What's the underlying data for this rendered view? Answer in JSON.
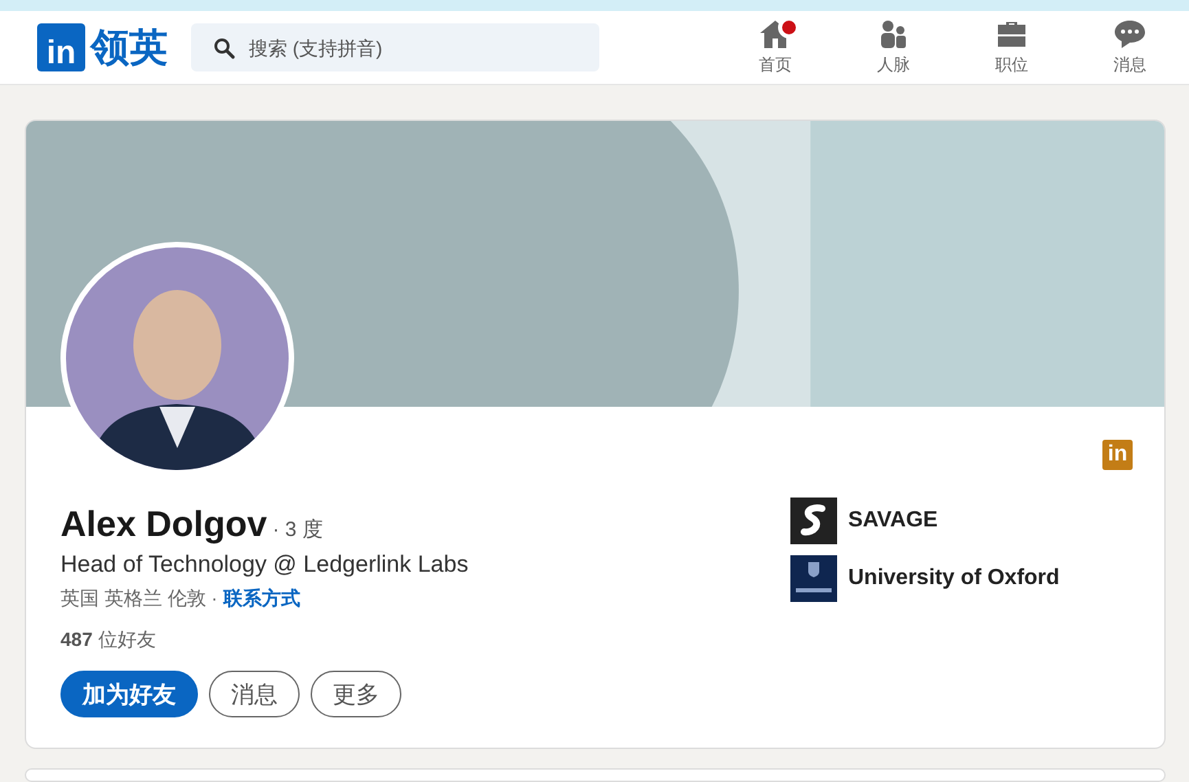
{
  "header": {
    "logo": {
      "mark": "in",
      "text": "领英"
    },
    "search": {
      "placeholder": "搜索 (支持拼音)"
    },
    "nav": [
      {
        "kind": "home",
        "label": "首页",
        "notification": true
      },
      {
        "kind": "people",
        "label": "人脉",
        "notification": false
      },
      {
        "kind": "jobs",
        "label": "职位",
        "notification": false
      },
      {
        "kind": "messages",
        "label": "消息",
        "notification": false
      }
    ]
  },
  "profile": {
    "badge": "in",
    "name": "Alex Dolgov",
    "degree": "· 3 度",
    "headline": "Head of Technology @ Ledgerlink Labs",
    "location": "英国 英格兰 伦敦 ·",
    "contact_link": "联系方式",
    "connections_count": "487",
    "connections_label": "位好友",
    "actions": [
      {
        "label": "加为好友",
        "primary": true
      },
      {
        "label": "消息",
        "primary": false
      },
      {
        "label": "更多",
        "primary": false
      }
    ],
    "organizations": [
      {
        "kind": "company",
        "name": "SAVAGE"
      },
      {
        "kind": "school",
        "name": "University of Oxford"
      }
    ]
  }
}
